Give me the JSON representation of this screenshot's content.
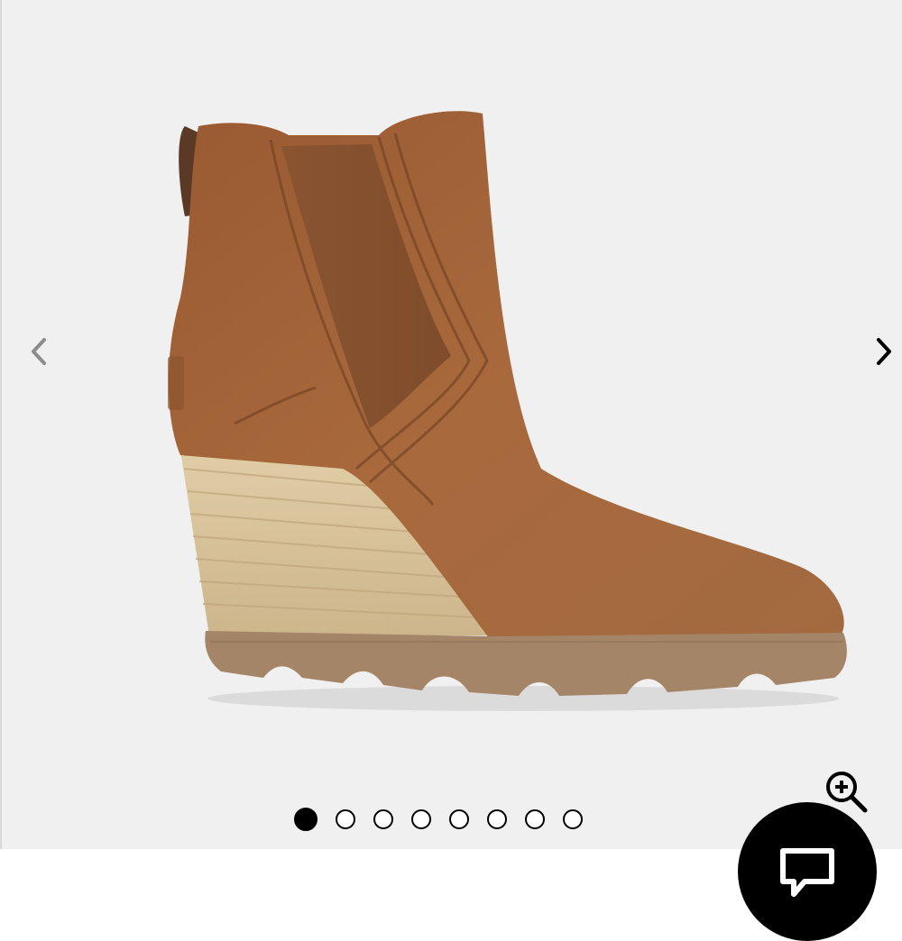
{
  "gallery": {
    "image_subject": "boot-product-photo",
    "total_slides": 8,
    "active_slide": 1,
    "icons": {
      "prev": "chevron-left-icon",
      "next": "chevron-right-icon",
      "zoom": "zoom-in-icon",
      "chat": "chat-bubble-icon"
    }
  },
  "colors": {
    "background": "#f1f0f0",
    "suede": "#a2643a",
    "sole": "#a58667",
    "wedge": "#d8c4a0",
    "accent": "#000000"
  }
}
